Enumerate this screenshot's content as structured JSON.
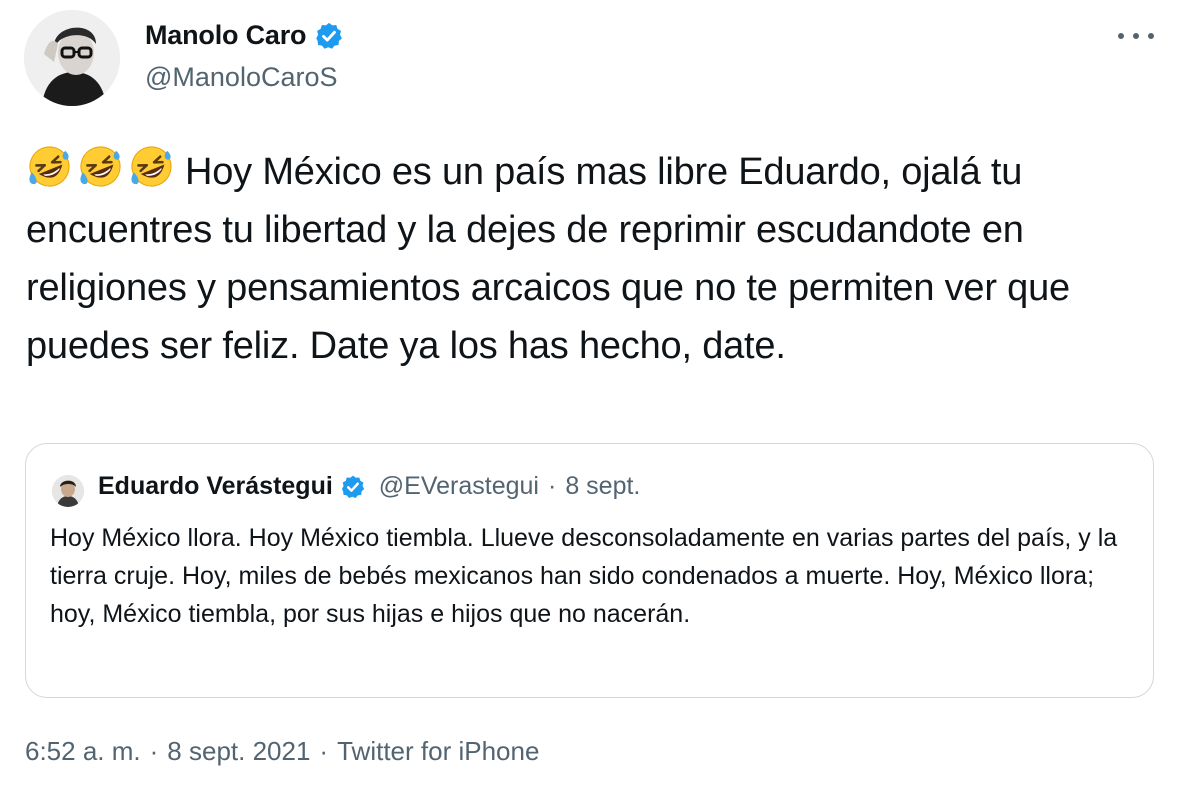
{
  "author": {
    "name": "Manolo Caro",
    "handle": "@ManoloCaroS",
    "verified": true
  },
  "tweet": {
    "emojis": [
      "rolling-on-floor-laughing",
      "rolling-on-floor-laughing",
      "rolling-on-floor-laughing"
    ],
    "text": "Hoy México es un país mas libre Eduardo, ojalá tu encuentres tu libertad y la dejes de reprimir escudandote en religiones y pensamientos arcaicos que no te permiten ver que puedes ser feliz. Date ya los has hecho, date."
  },
  "quoted_tweet": {
    "name": "Eduardo Verástegui",
    "handle": "@EVerastegui",
    "separator": "·",
    "date": "8 sept.",
    "verified": true,
    "text": "Hoy México llora. Hoy México tiembla. Llueve desconsoladamente en varias partes del país, y la tierra cruje. Hoy, miles de bebés mexicanos han sido condenados a muerte. Hoy, México llora; hoy, México tiembla, por sus hijas e hijos que no nacerán."
  },
  "meta": {
    "time": "6:52 a. m.",
    "date": "8 sept. 2021",
    "source": "Twitter for iPhone",
    "separator": "·"
  },
  "colors": {
    "text": "#0f1419",
    "secondary": "#536471",
    "verified": "#1d9bf0",
    "border": "#cfd9de"
  }
}
